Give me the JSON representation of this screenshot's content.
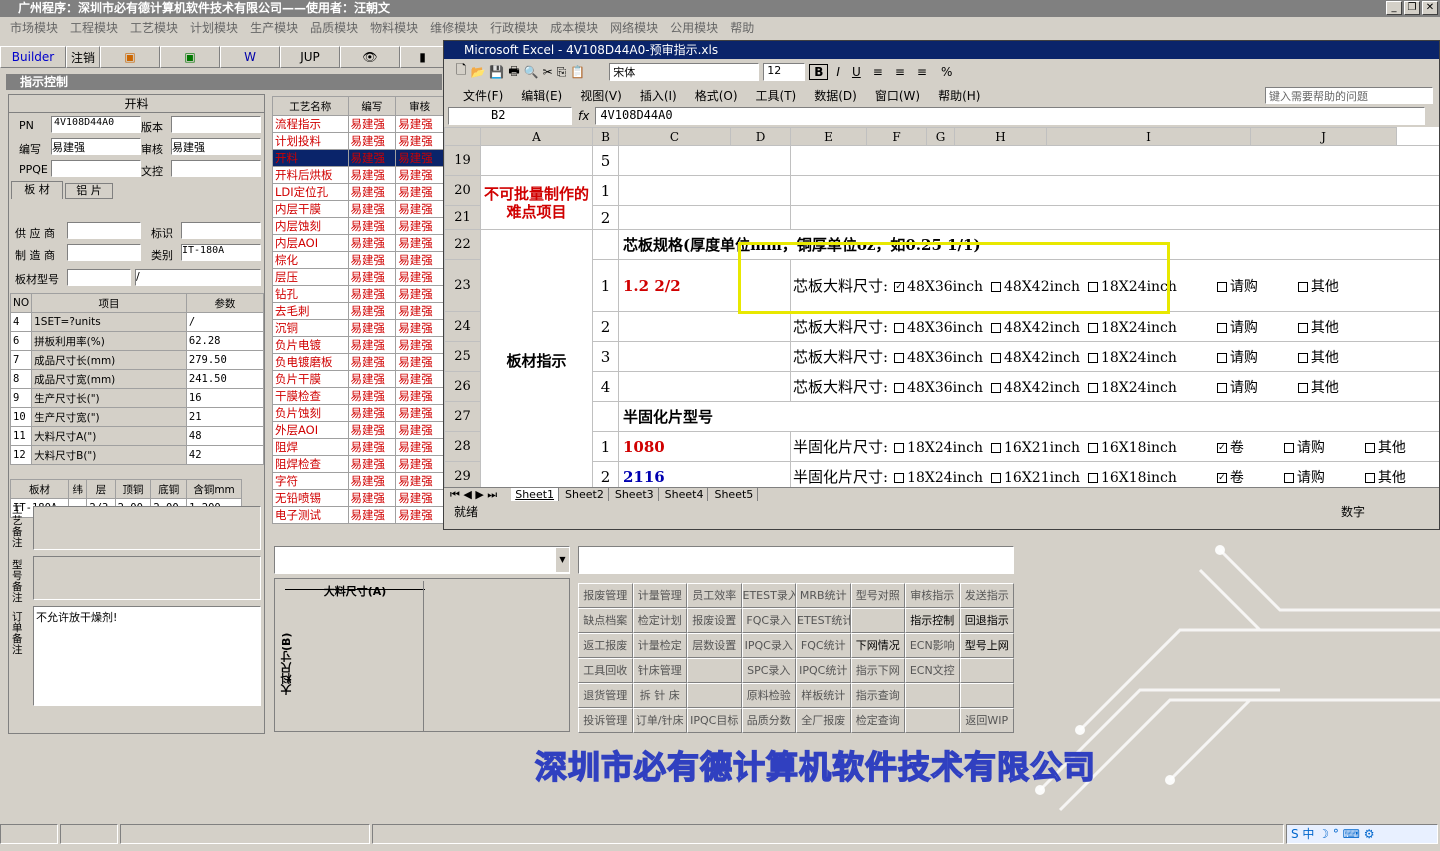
{
  "app": {
    "title": "广州程序：深圳市必有德计算机软件技术有限公司——使用者：汪朝文"
  },
  "menu": [
    "市场模块",
    "工程模块",
    "工艺模块",
    "计划模块",
    "生产模块",
    "品质模块",
    "物料模块",
    "维修模块",
    "行政模块",
    "成本模块",
    "网络模块",
    "公用模块",
    "帮助"
  ],
  "toolbar": {
    "builder": "Builder",
    "logout": "注销",
    "jup": "JUP"
  },
  "panel": {
    "title": "指示控制",
    "section": "开料"
  },
  "form": {
    "pn_label": "PN",
    "pn_value": "4V108D44A0",
    "version_label": "版本",
    "author_label": "编写",
    "author_value": "易建强",
    "reviewer_label": "审核",
    "reviewer_value": "易建强",
    "ppqe_label": "PPQE",
    "doc_label": "文控",
    "tab1": "板 材",
    "tab2": "铝 片",
    "supplier_label": "供 应 商",
    "mark_label": "标识",
    "maker_label": "制 造 商",
    "category_label": "类别",
    "category_value": "IT-180A",
    "model_label": "板材型号",
    "model_value": "/"
  },
  "params": {
    "headers": [
      "NO",
      "项目",
      "参数"
    ],
    "rows": [
      [
        "4",
        "1SET=?units",
        "/"
      ],
      [
        "6",
        "拼板利用率(%)",
        "62.28"
      ],
      [
        "7",
        "成品尺寸长(mm)",
        "279.50"
      ],
      [
        "8",
        "成品尺寸宽(mm)",
        "241.50"
      ],
      [
        "9",
        "生产尺寸长(\")",
        "16"
      ],
      [
        "10",
        "生产尺寸宽(\")",
        "21"
      ],
      [
        "11",
        "大料尺寸A(\")",
        "48"
      ],
      [
        "12",
        "大料尺寸B(\")",
        "42"
      ]
    ]
  },
  "material": {
    "headers": [
      "板材",
      "纬",
      "层",
      "顶铜",
      "底铜",
      "含铜mm"
    ],
    "row": [
      "IT-180A",
      "",
      "2/3",
      "2.00",
      "2.00",
      "1.200"
    ]
  },
  "notes": {
    "process_label": "工艺备注",
    "model_label": "型号备注",
    "order_label": "订单备注",
    "order_text": "不允许放干燥剂!"
  },
  "process": {
    "headers": [
      "工艺名称",
      "编写",
      "审核"
    ],
    "rows": [
      [
        "流程指示",
        "易建强",
        "易建强"
      ],
      [
        "计划投料",
        "易建强",
        "易建强"
      ],
      [
        "开料",
        "易建强",
        "易建强"
      ],
      [
        "开料后烘板",
        "易建强",
        "易建强"
      ],
      [
        "LDI定位孔",
        "易建强",
        "易建强"
      ],
      [
        "内层干膜",
        "易建强",
        "易建强"
      ],
      [
        "内层蚀刻",
        "易建强",
        "易建强"
      ],
      [
        "内层AOI",
        "易建强",
        "易建强"
      ],
      [
        "棕化",
        "易建强",
        "易建强"
      ],
      [
        "层压",
        "易建强",
        "易建强"
      ],
      [
        "钻孔",
        "易建强",
        "易建强"
      ],
      [
        "去毛刺",
        "易建强",
        "易建强"
      ],
      [
        "沉铜",
        "易建强",
        "易建强"
      ],
      [
        "负片电镀",
        "易建强",
        "易建强"
      ],
      [
        "负电镀磨板",
        "易建强",
        "易建强"
      ],
      [
        "负片干膜",
        "易建强",
        "易建强"
      ],
      [
        "干膜检查",
        "易建强",
        "易建强"
      ],
      [
        "负片蚀刻",
        "易建强",
        "易建强"
      ],
      [
        "外层AOI",
        "易建强",
        "易建强"
      ],
      [
        "阻焊",
        "易建强",
        "易建强"
      ],
      [
        "阻焊检查",
        "易建强",
        "易建强"
      ],
      [
        "字符",
        "易建强",
        "易建强"
      ],
      [
        "无铅喷锡",
        "易建强",
        "易建强"
      ],
      [
        "电子测试",
        "易建强",
        "易建强"
      ]
    ]
  },
  "diagram": {
    "a_label": "大料尺寸(A)",
    "b_label": "大料尺寸(B)"
  },
  "buttons": [
    [
      "报废管理",
      "计量管理",
      "员工效率",
      "ETEST录入",
      "MRB统计",
      "型号对照",
      "审核指示",
      "发送指示"
    ],
    [
      "缺点档案",
      "检定计划",
      "报废设置",
      "FQC录入",
      "ETEST统计",
      "",
      "指示控制",
      "回退指示"
    ],
    [
      "返工报废",
      "计量检定",
      "层数设置",
      "IPQC录入",
      "FQC统计",
      "下网情况",
      "ECN影响",
      "型号上网"
    ],
    [
      "工具回收",
      "针床管理",
      "",
      "SPC录入",
      "IPQC统计",
      "指示下网",
      "ECN文控",
      ""
    ],
    [
      "退货管理",
      "拆 针 床",
      "",
      "原料检验",
      "样板统计",
      "指示查询",
      "",
      ""
    ],
    [
      "投诉管理",
      "订单/针床",
      "IPQC目标",
      "品质分数",
      "全厂报废",
      "检定查询",
      "",
      "返回WIP"
    ]
  ],
  "active_buttons": [
    "指示控制",
    "回退指示",
    "下网情况",
    "型号上网"
  ],
  "company": "深圳市必有德计算机软件技术有限公司",
  "excel": {
    "title": "Microsoft Excel - 4V108D44A0-预审指示.xls",
    "menu": [
      "文件(F)",
      "编辑(E)",
      "视图(V)",
      "插入(I)",
      "格式(O)",
      "工具(T)",
      "数据(D)",
      "窗口(W)",
      "帮助(H)"
    ],
    "help_placeholder": "键入需要帮助的问题",
    "font": "宋体",
    "size": "12",
    "namebox": "B2",
    "formula": "4V108D44A0",
    "columns": [
      "A",
      "B",
      "C",
      "D",
      "E",
      "F",
      "G",
      "H",
      "I",
      "J"
    ],
    "rows": [
      {
        "no": "19",
        "b": "5",
        "c": "",
        "d": ""
      },
      {
        "no": "20",
        "b": "1",
        "c": "",
        "d": ""
      },
      {
        "no": "21",
        "b": "2",
        "c": "",
        "d": ""
      },
      {
        "no": "22",
        "b": "",
        "c": "芯板规格(厚度单位mm，铜厚单位oz，如0.25 1/1)",
        "d": ""
      },
      {
        "no": "23",
        "b": "1",
        "c": "1.2 2/2",
        "d": "芯板大料尺寸:"
      },
      {
        "no": "24",
        "b": "2",
        "c": "",
        "d": "芯板大料尺寸:"
      },
      {
        "no": "25",
        "b": "3",
        "c": "",
        "d": "芯板大料尺寸:"
      },
      {
        "no": "26",
        "b": "4",
        "c": "",
        "d": "芯板大料尺寸:"
      },
      {
        "no": "27",
        "b": "",
        "c": "半固化片型号",
        "d": ""
      },
      {
        "no": "28",
        "b": "1",
        "c": "1080",
        "d": "半固化片尺寸:"
      },
      {
        "no": "29",
        "b": "2",
        "c": "2116",
        "d": "半固化片尺寸:"
      }
    ],
    "merged_a1": "不可批量制作的难点项目",
    "merged_a2": "板材指示",
    "core_options": [
      "48X36inch",
      "48X42inch",
      "18X24inch",
      "请购",
      "其他"
    ],
    "pp_options": [
      "18X24inch",
      "16X21inch",
      "16X18inch",
      "卷",
      "请购",
      "其他"
    ],
    "sheets": [
      "Sheet1",
      "Sheet2",
      "Sheet3",
      "Sheet4",
      "Sheet5"
    ],
    "status_left": "就绪",
    "status_right": "数字"
  }
}
